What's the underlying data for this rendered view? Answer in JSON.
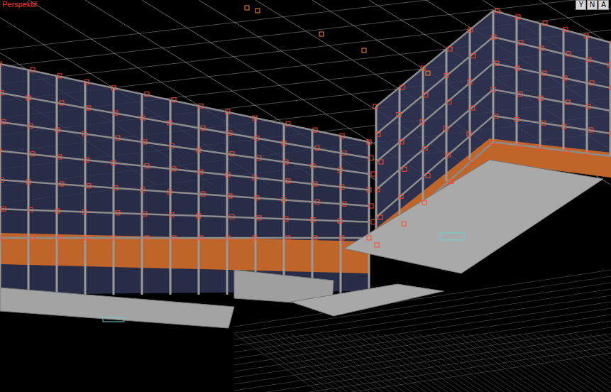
{
  "viewport": {
    "label": "Perspektif"
  },
  "gizmo": {
    "axes": [
      "Y",
      "N",
      "A"
    ]
  }
}
